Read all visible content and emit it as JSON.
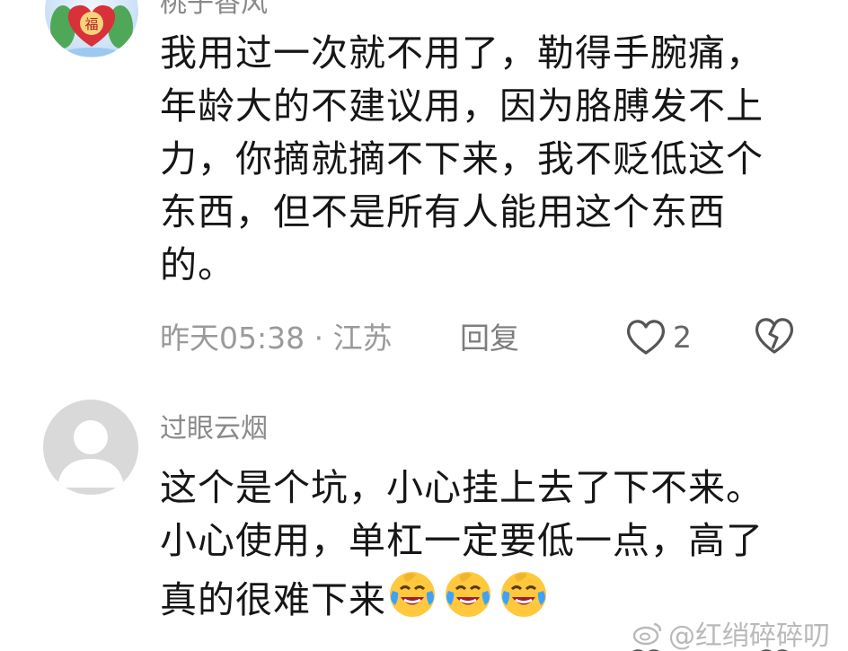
{
  "comments": [
    {
      "username": "桃子香风",
      "text_lines": [
        "我用过一次就不用了，勒得手腕痛，",
        "年龄大的不建议用，因为胳膊发不上",
        "力，你摘就摘不下来，我不贬低这个",
        "东西，但不是所有人能用这个东西",
        "的。"
      ],
      "meta": "昨天05:38 · 江苏",
      "reply_label": "回复",
      "like_count": "2",
      "avatar_badge_text": "福"
    },
    {
      "username": "过眼云烟",
      "text_lines": [
        "这个是个坑，小心挂上去了下不来。",
        "小心使用，单杠一定要低一点，高了",
        "真的很难下来"
      ],
      "emojis": [
        "crying-laughing-emoji",
        "crying-laughing-emoji",
        "crying-laughing-emoji"
      ]
    }
  ],
  "watermark": "@红绡碎碎叨",
  "colors": {
    "text": "#161616",
    "muted": "#9a9a9a",
    "avatar_default": "#d9d9d9",
    "emoji_yellow": "#ffc83d"
  }
}
